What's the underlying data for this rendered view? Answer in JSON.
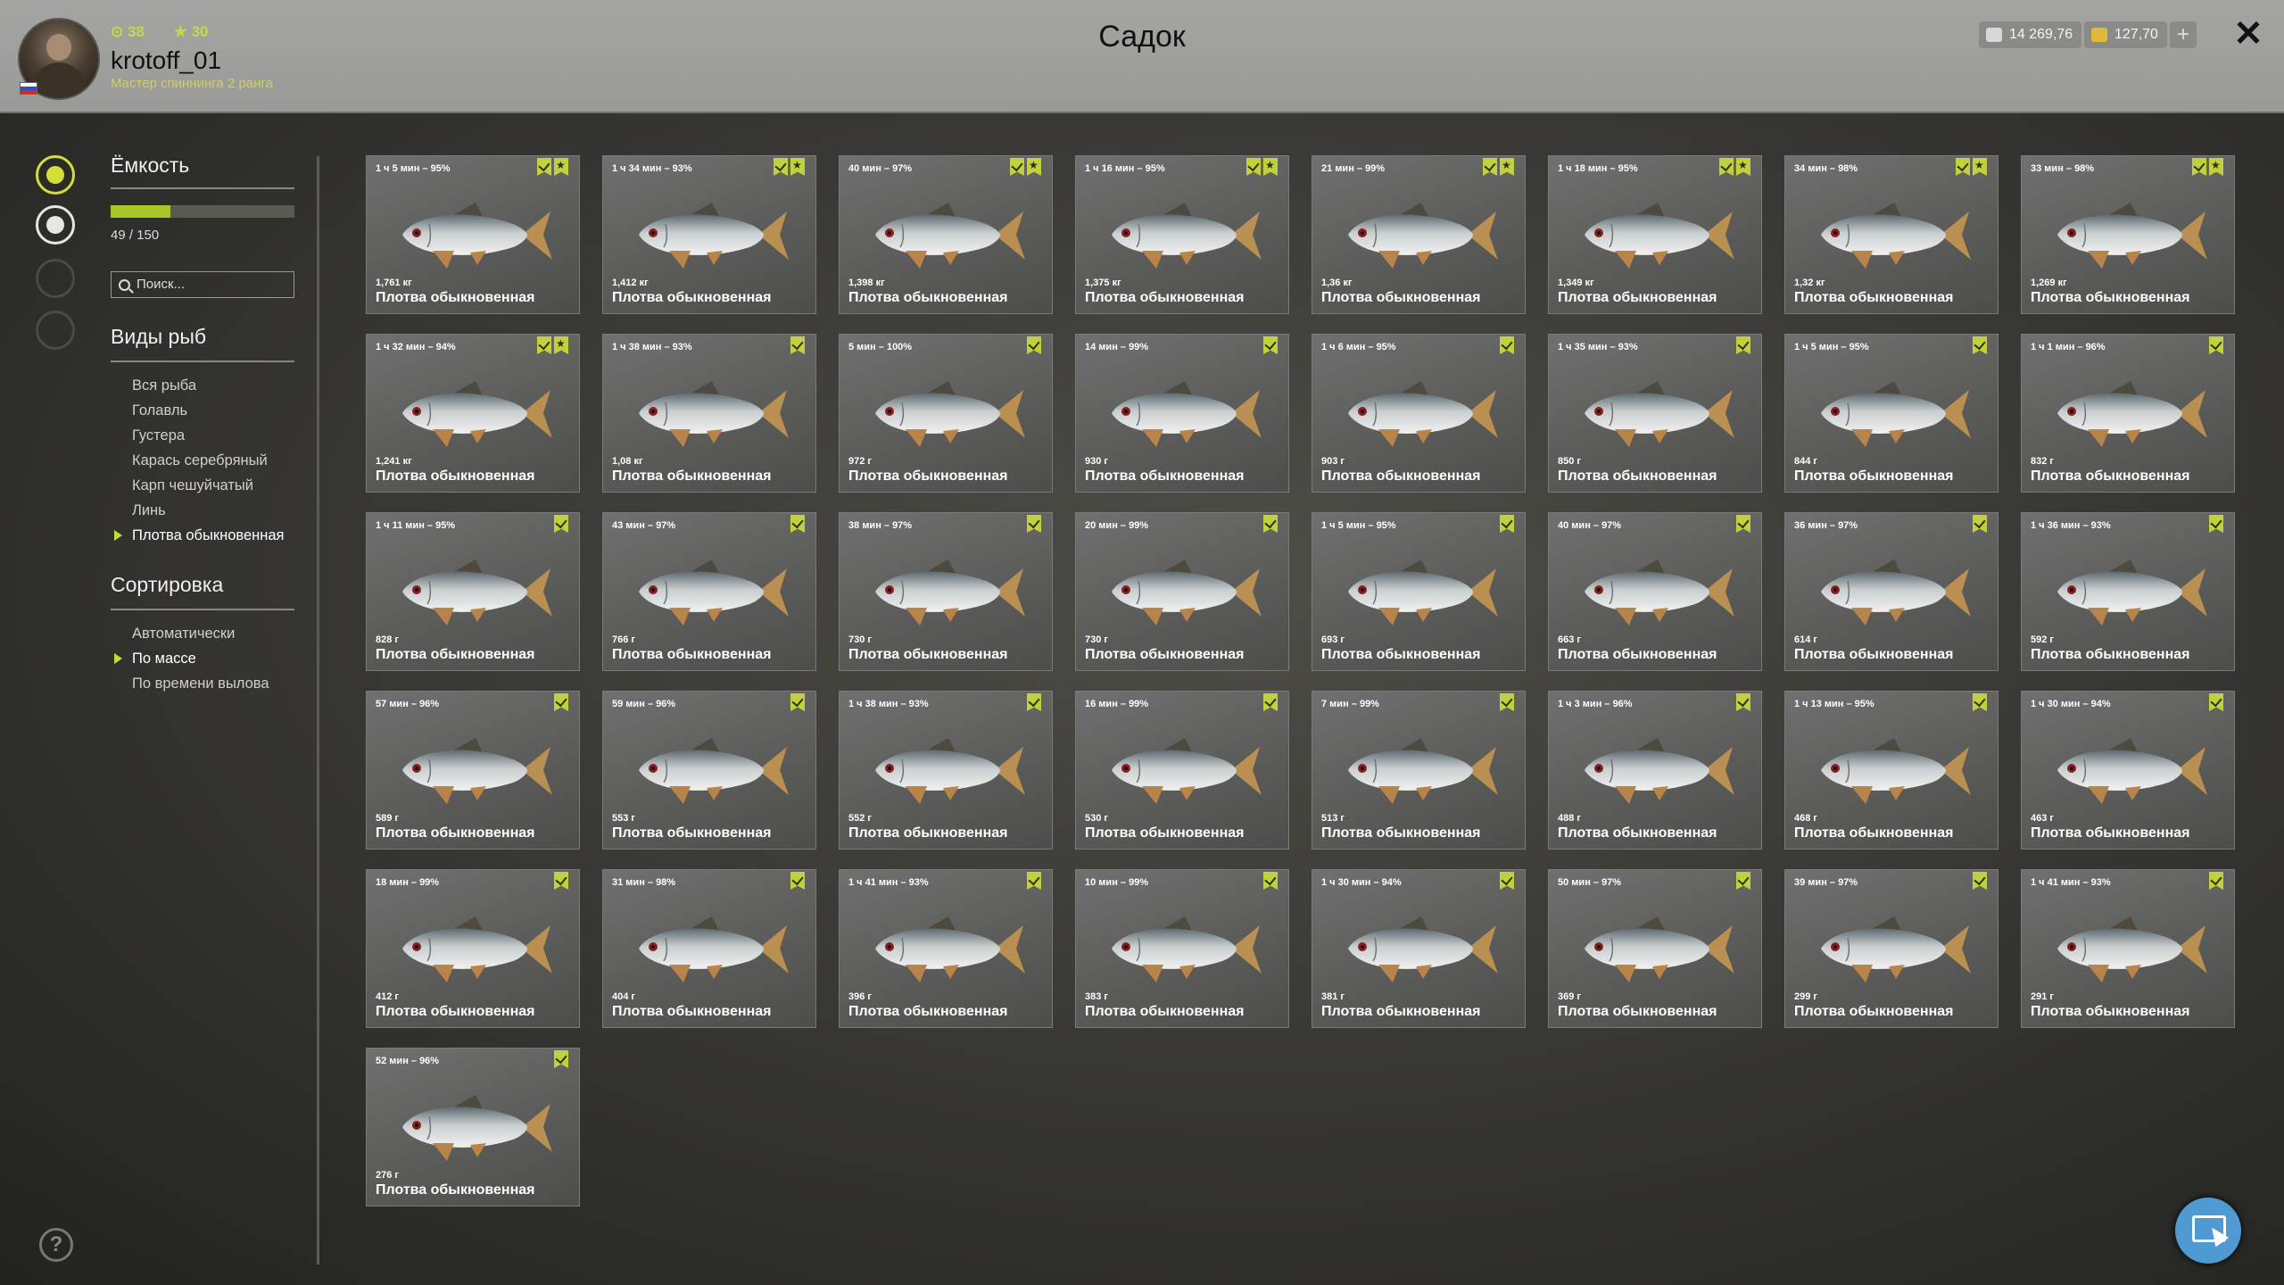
{
  "header": {
    "title": "Садок",
    "player": {
      "level": "38",
      "rank_level": "30",
      "name": "krotoff_01",
      "title": "Мастер спиннинга 2 ранга"
    },
    "silver": "14 269,76",
    "gold": "127,70",
    "plus_label": "+",
    "close_label": "✕"
  },
  "sidebar": {
    "capacity_label": "Ёмкость",
    "capacity_fraction": 0.3267,
    "capacity_text": "49 / 150",
    "search_placeholder": "Поиск...",
    "species_label": "Виды рыб",
    "species": [
      "Вся рыба",
      "Голавль",
      "Густера",
      "Карась серебряный",
      "Карп чешуйчатый",
      "Линь",
      "Плотва обыкновенная"
    ],
    "species_selected": "Плотва обыкновенная",
    "sort_label": "Сортировка",
    "sort": [
      "Автоматически",
      "По массе",
      "По времени вылова"
    ],
    "sort_selected": "По массе"
  },
  "help_label": "?",
  "fish": [
    {
      "time": "1 ч 5 мин – 95%",
      "weight": "1,761 кг",
      "name": "Плотва обыкновенная",
      "badges": [
        "check",
        "star"
      ]
    },
    {
      "time": "1 ч 34 мин – 93%",
      "weight": "1,412 кг",
      "name": "Плотва обыкновенная",
      "badges": [
        "check",
        "star"
      ]
    },
    {
      "time": "40 мин – 97%",
      "weight": "1,398 кг",
      "name": "Плотва обыкновенная",
      "badges": [
        "check",
        "star"
      ]
    },
    {
      "time": "1 ч 16 мин – 95%",
      "weight": "1,375 кг",
      "name": "Плотва обыкновенная",
      "badges": [
        "check",
        "star"
      ]
    },
    {
      "time": "21 мин – 99%",
      "weight": "1,36 кг",
      "name": "Плотва обыкновенная",
      "badges": [
        "check",
        "star"
      ]
    },
    {
      "time": "1 ч 18 мин – 95%",
      "weight": "1,349 кг",
      "name": "Плотва обыкновенная",
      "badges": [
        "check",
        "star"
      ]
    },
    {
      "time": "34 мин – 98%",
      "weight": "1,32 кг",
      "name": "Плотва обыкновенная",
      "badges": [
        "check",
        "star"
      ]
    },
    {
      "time": "33 мин – 98%",
      "weight": "1,269 кг",
      "name": "Плотва обыкновенная",
      "badges": [
        "check",
        "star"
      ]
    },
    {
      "time": "1 ч 32 мин – 94%",
      "weight": "1,241 кг",
      "name": "Плотва обыкновенная",
      "badges": [
        "check",
        "star"
      ]
    },
    {
      "time": "1 ч 38 мин – 93%",
      "weight": "1,08 кг",
      "name": "Плотва обыкновенная",
      "badges": [
        "check"
      ]
    },
    {
      "time": "5 мин – 100%",
      "weight": "972 г",
      "name": "Плотва обыкновенная",
      "badges": [
        "check"
      ]
    },
    {
      "time": "14 мин – 99%",
      "weight": "930 г",
      "name": "Плотва обыкновенная",
      "badges": [
        "check"
      ]
    },
    {
      "time": "1 ч 6 мин – 95%",
      "weight": "903 г",
      "name": "Плотва обыкновенная",
      "badges": [
        "check"
      ]
    },
    {
      "time": "1 ч 35 мин – 93%",
      "weight": "850 г",
      "name": "Плотва обыкновенная",
      "badges": [
        "check"
      ]
    },
    {
      "time": "1 ч 5 мин – 95%",
      "weight": "844 г",
      "name": "Плотва обыкновенная",
      "badges": [
        "check"
      ]
    },
    {
      "time": "1 ч 1 мин – 96%",
      "weight": "832 г",
      "name": "Плотва обыкновенная",
      "badges": [
        "check"
      ]
    },
    {
      "time": "1 ч 11 мин – 95%",
      "weight": "828 г",
      "name": "Плотва обыкновенная",
      "badges": [
        "check"
      ]
    },
    {
      "time": "43 мин – 97%",
      "weight": "766 г",
      "name": "Плотва обыкновенная",
      "badges": [
        "check"
      ]
    },
    {
      "time": "38 мин – 97%",
      "weight": "730 г",
      "name": "Плотва обыкновенная",
      "badges": [
        "check"
      ]
    },
    {
      "time": "20 мин – 99%",
      "weight": "730 г",
      "name": "Плотва обыкновенная",
      "badges": [
        "check"
      ]
    },
    {
      "time": "1 ч 5 мин – 95%",
      "weight": "693 г",
      "name": "Плотва обыкновенная",
      "badges": [
        "check"
      ]
    },
    {
      "time": "40 мин – 97%",
      "weight": "663 г",
      "name": "Плотва обыкновенная",
      "badges": [
        "check"
      ]
    },
    {
      "time": "36 мин – 97%",
      "weight": "614 г",
      "name": "Плотва обыкновенная",
      "badges": [
        "check"
      ]
    },
    {
      "time": "1 ч 36 мин – 93%",
      "weight": "592 г",
      "name": "Плотва обыкновенная",
      "badges": [
        "check"
      ]
    },
    {
      "time": "57 мин – 96%",
      "weight": "589 г",
      "name": "Плотва обыкновенная",
      "badges": [
        "check"
      ]
    },
    {
      "time": "59 мин – 96%",
      "weight": "553 г",
      "name": "Плотва обыкновенная",
      "badges": [
        "check"
      ]
    },
    {
      "time": "1 ч 38 мин – 93%",
      "weight": "552 г",
      "name": "Плотва обыкновенная",
      "badges": [
        "check"
      ]
    },
    {
      "time": "16 мин – 99%",
      "weight": "530 г",
      "name": "Плотва обыкновенная",
      "badges": [
        "check"
      ]
    },
    {
      "time": "7 мин – 99%",
      "weight": "513 г",
      "name": "Плотва обыкновенная",
      "badges": [
        "check"
      ]
    },
    {
      "time": "1 ч 3 мин – 96%",
      "weight": "488 г",
      "name": "Плотва обыкновенная",
      "badges": [
        "check"
      ]
    },
    {
      "time": "1 ч 13 мин – 95%",
      "weight": "468 г",
      "name": "Плотва обыкновенная",
      "badges": [
        "check"
      ]
    },
    {
      "time": "1 ч 30 мин – 94%",
      "weight": "463 г",
      "name": "Плотва обыкновенная",
      "badges": [
        "check"
      ]
    },
    {
      "time": "18 мин – 99%",
      "weight": "412 г",
      "name": "Плотва обыкновенная",
      "badges": [
        "check"
      ]
    },
    {
      "time": "31 мин – 98%",
      "weight": "404 г",
      "name": "Плотва обыкновенная",
      "badges": [
        "check"
      ]
    },
    {
      "time": "1 ч 41 мин – 93%",
      "weight": "396 г",
      "name": "Плотва обыкновенная",
      "badges": [
        "check"
      ]
    },
    {
      "time": "10 мин – 99%",
      "weight": "383 г",
      "name": "Плотва обыкновенная",
      "badges": [
        "check"
      ]
    },
    {
      "time": "1 ч 30 мин – 94%",
      "weight": "381 г",
      "name": "Плотва обыкновенная",
      "badges": [
        "check"
      ]
    },
    {
      "time": "50 мин – 97%",
      "weight": "369 г",
      "name": "Плотва обыкновенная",
      "badges": [
        "check"
      ]
    },
    {
      "time": "39 мин – 97%",
      "weight": "299 г",
      "name": "Плотва обыкновенная",
      "badges": [
        "check"
      ]
    },
    {
      "time": "1 ч 41 мин – 93%",
      "weight": "291 г",
      "name": "Плотва обыкновенная",
      "badges": [
        "check"
      ]
    },
    {
      "time": "52 мин – 96%",
      "weight": "276 г",
      "name": "Плотва обыкновенная",
      "badges": [
        "check"
      ]
    }
  ],
  "colors": {
    "accent": "#c2d040",
    "cursor_button": "#4f9ad2"
  }
}
